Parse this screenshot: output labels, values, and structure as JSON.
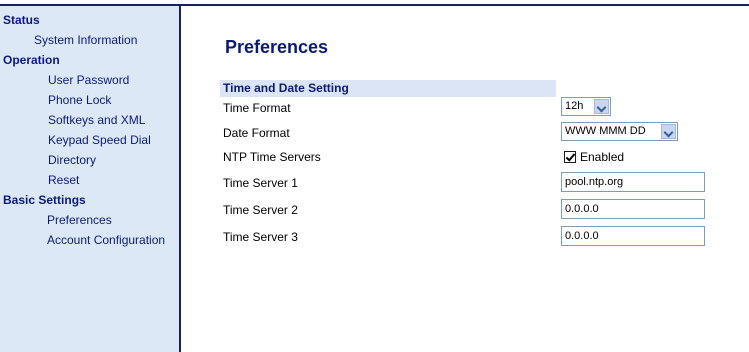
{
  "sidebar": {
    "sections": [
      {
        "label": "Status",
        "items": [
          "System Information"
        ]
      },
      {
        "label": "Operation",
        "items": [
          "User Password",
          "Phone Lock",
          "Softkeys and XML",
          "Keypad Speed Dial",
          "Directory",
          "Reset"
        ]
      },
      {
        "label": "Basic Settings",
        "items": [
          "Preferences",
          "Account Configuration"
        ]
      }
    ]
  },
  "main": {
    "title": "Preferences",
    "section_header": "Time and Date Setting",
    "fields": {
      "time_format": {
        "label": "Time Format",
        "value": "12h"
      },
      "date_format": {
        "label": "Date Format",
        "value": "WWW MMM DD"
      },
      "ntp": {
        "label": "NTP Time Servers",
        "checkbox_label": "Enabled",
        "checked": true
      },
      "server1": {
        "label": "Time Server 1",
        "value": "pool.ntp.org"
      },
      "server2": {
        "label": "Time Server 2",
        "value": "0.0.0.0"
      },
      "server3": {
        "label": "Time Server 3",
        "value": "0.0.0.0"
      }
    }
  }
}
